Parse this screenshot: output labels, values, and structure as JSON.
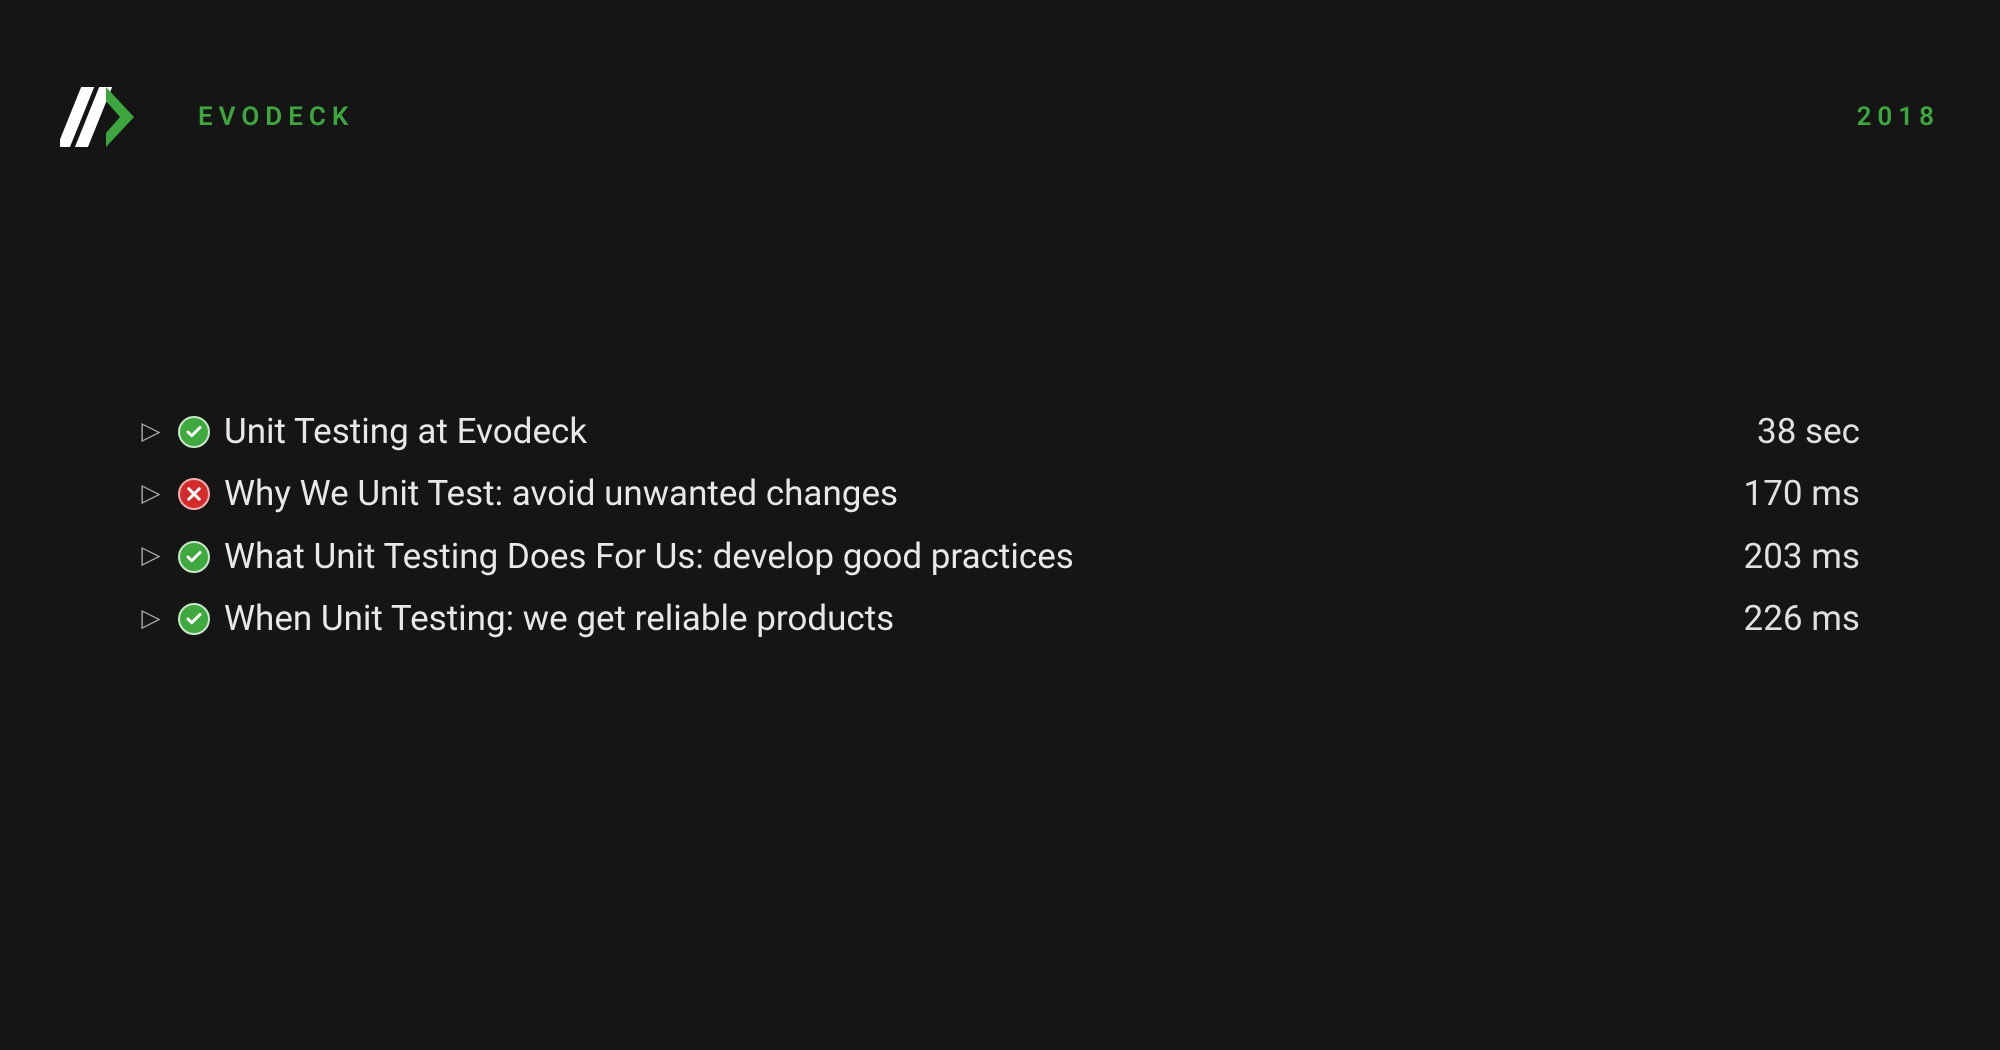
{
  "header": {
    "brand": "EVODECK",
    "year": "2018"
  },
  "tests": [
    {
      "status": "pass",
      "title": "Unit Testing at Evodeck",
      "duration": "38 sec"
    },
    {
      "status": "fail",
      "title": "Why We Unit Test: avoid unwanted changes",
      "duration": "170 ms"
    },
    {
      "status": "pass",
      "title": "What Unit Testing Does For Us: develop good practices",
      "duration": "203 ms"
    },
    {
      "status": "pass",
      "title": "When Unit Testing: we get reliable products",
      "duration": "226 ms"
    }
  ],
  "colors": {
    "background": "#151515",
    "accent": "#3ea63e",
    "pass": "#3fa93f",
    "fail": "#d42a2a",
    "text": "#e8e8e8"
  }
}
